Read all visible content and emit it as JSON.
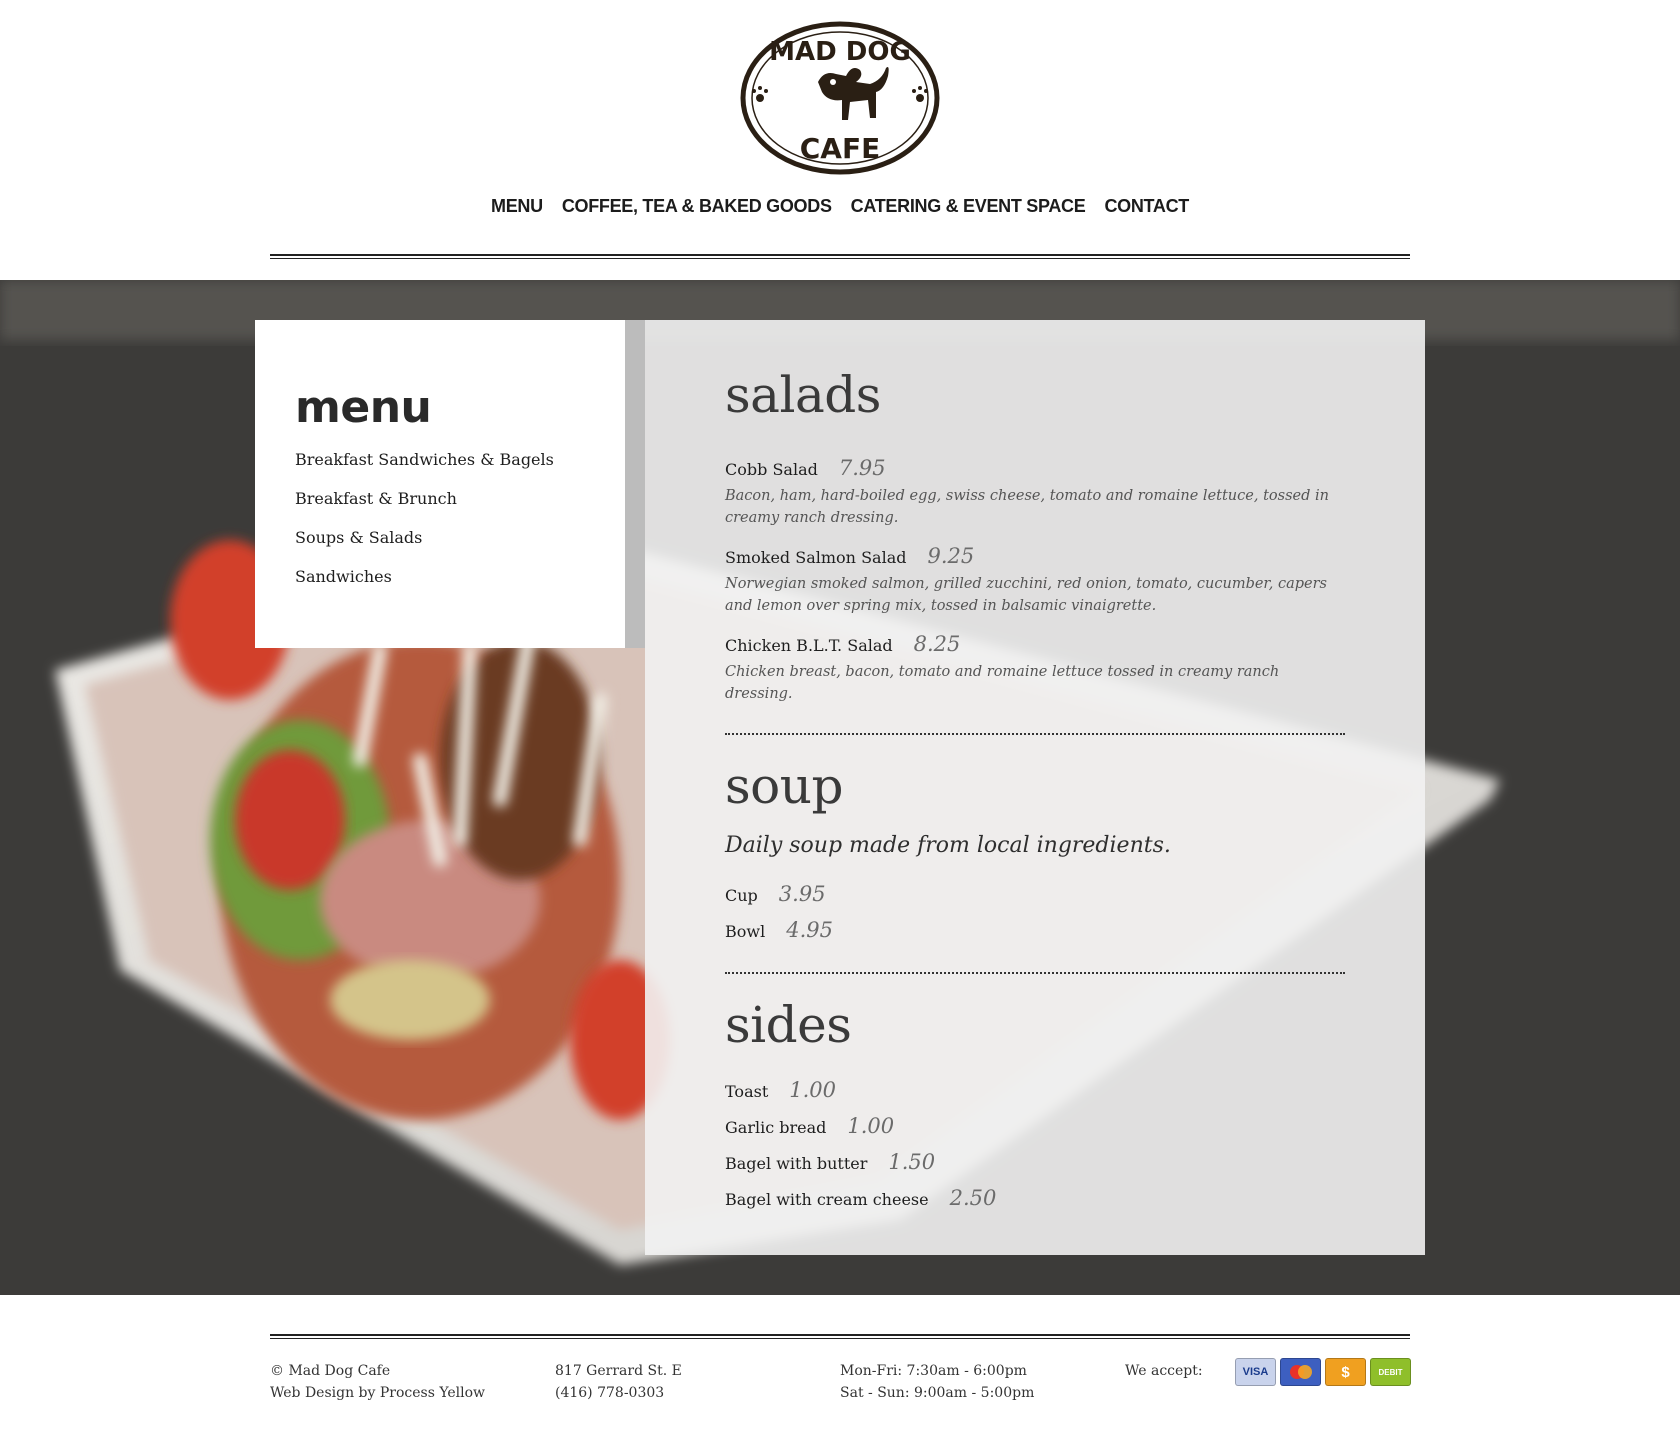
{
  "brand": {
    "logo_top": "MAD DOG",
    "logo_bottom": "CAFE"
  },
  "nav": [
    "MENU",
    "COFFEE, TEA & BAKED GOODS",
    "CATERING & EVENT SPACE",
    "CONTACT"
  ],
  "sidebar": {
    "title": "menu",
    "items": [
      "Breakfast Sandwiches & Bagels",
      "Breakfast & Brunch",
      "Soups & Salads",
      "Sandwiches"
    ]
  },
  "salads": {
    "title": "salads",
    "items": [
      {
        "name": "Cobb Salad",
        "price": "7.95",
        "desc": "Bacon, ham, hard-boiled egg, swiss cheese, tomato and romaine lettuce, tossed in creamy ranch dressing."
      },
      {
        "name": "Smoked Salmon Salad",
        "price": "9.25",
        "desc": "Norwegian smoked salmon, grilled zucchini, red onion, tomato, cucumber, capers and lemon over spring mix, tossed in balsamic vinaigrette."
      },
      {
        "name": "Chicken B.L.T. Salad",
        "price": "8.25",
        "desc": "Chicken breast, bacon, tomato and romaine lettuce tossed in creamy ranch dressing."
      }
    ]
  },
  "soup": {
    "title": "soup",
    "tagline": "Daily soup made from local ingredients.",
    "items": [
      {
        "name": "Cup",
        "price": "3.95"
      },
      {
        "name": "Bowl",
        "price": "4.95"
      }
    ]
  },
  "sides": {
    "title": "sides",
    "items": [
      {
        "name": "Toast",
        "price": "1.00"
      },
      {
        "name": "Garlic bread",
        "price": "1.00"
      },
      {
        "name": "Bagel with butter",
        "price": "1.50"
      },
      {
        "name": "Bagel with cream cheese",
        "price": "2.50"
      }
    ]
  },
  "footer": {
    "copyright": "© Mad Dog Cafe",
    "credit": "Web Design by Process Yellow",
    "address": "817 Gerrard St. E",
    "phone": "(416) 778-0303",
    "hours_weekday": "Mon-Fri: 7:30am - 6:00pm",
    "hours_weekend": "Sat - Sun: 9:00am - 5:00pm",
    "accept_label": "We accept:",
    "cards": [
      {
        "label": "VISA",
        "color": "#c9d3ec",
        "text_color": "#1a3b8c"
      },
      {
        "label": "",
        "color": "#3d5fc0",
        "text_color": "#ffffff"
      },
      {
        "label": "$",
        "color": "#f0a020",
        "text_color": "#ffffff"
      },
      {
        "label": "DEBIT",
        "color": "#8fbf2a",
        "text_color": "#ffffff"
      }
    ]
  }
}
